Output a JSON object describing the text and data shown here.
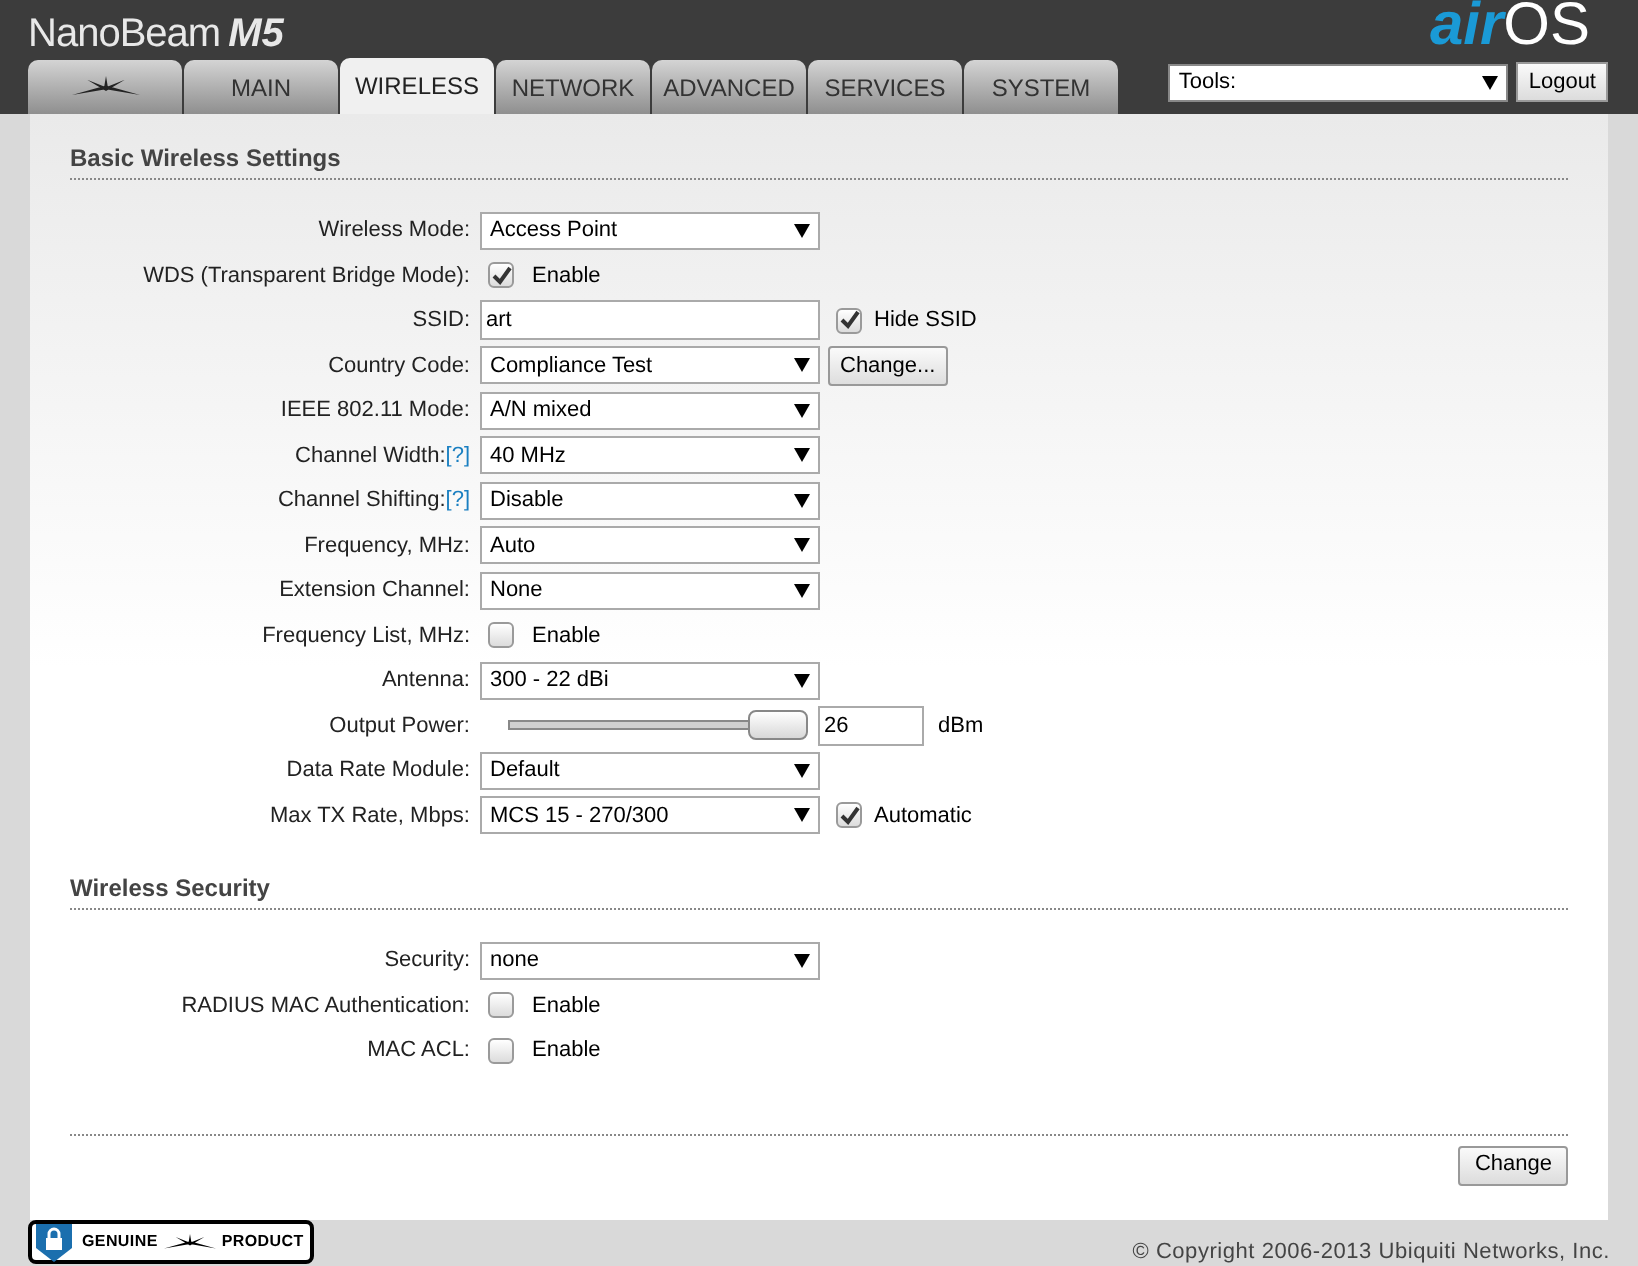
{
  "header": {
    "product": "NanoBeam",
    "model": "M5",
    "brand_a": "air",
    "brand_b": "OS"
  },
  "tabs": [
    {
      "kind": "logo",
      "selected": false
    },
    {
      "label": "MAIN",
      "selected": false
    },
    {
      "label": "WIRELESS",
      "selected": true
    },
    {
      "label": "NETWORK",
      "selected": false
    },
    {
      "label": "ADVANCED",
      "selected": false
    },
    {
      "label": "SERVICES",
      "selected": false
    },
    {
      "label": "SYSTEM",
      "selected": false
    }
  ],
  "tools": {
    "value": "Tools:"
  },
  "logout": "Logout",
  "sections": [
    {
      "title": "Basic Wireless Settings",
      "rows": [
        {
          "kind": "select",
          "label": "Wireless Mode:",
          "value": "Access Point"
        },
        {
          "kind": "checkbox",
          "label": "WDS (Transparent Bridge Mode):",
          "checked": true,
          "text": "Enable"
        },
        {
          "kind": "text",
          "label": "SSID:",
          "value": "art",
          "extra_check": {
            "checked": true,
            "text": "Hide SSID"
          }
        },
        {
          "kind": "select",
          "label": "Country Code:",
          "value": "Compliance Test",
          "button": "Change..."
        },
        {
          "kind": "select",
          "label": "IEEE 802.11 Mode:",
          "value": "A/N mixed"
        },
        {
          "kind": "select",
          "label": "Channel Width:",
          "help": "[?]",
          "value": "40 MHz"
        },
        {
          "kind": "select",
          "label": "Channel Shifting:",
          "help": "[?]",
          "value": "Disable"
        },
        {
          "kind": "select",
          "label": "Frequency, MHz:",
          "value": "Auto"
        },
        {
          "kind": "select",
          "label": "Extension Channel:",
          "value": "None"
        },
        {
          "kind": "checkbox",
          "label": "Frequency List, MHz:",
          "checked": false,
          "text": "Enable"
        },
        {
          "kind": "select",
          "label": "Antenna:",
          "value": "300 - 22 dBi"
        },
        {
          "kind": "slider",
          "label": "Output Power:",
          "level": 1,
          "value": "26",
          "unit": "dBm"
        },
        {
          "kind": "select",
          "label": "Data Rate Module:",
          "value": "Default"
        },
        {
          "kind": "select",
          "label": "Max TX Rate, Mbps:",
          "value": "MCS 15 - 270/300",
          "extra_check": {
            "checked": true,
            "text": "Automatic"
          }
        }
      ]
    },
    {
      "title": "Wireless Security",
      "rows": [
        {
          "kind": "select",
          "label": "Security:",
          "value": "none"
        },
        {
          "kind": "checkbox",
          "label": "RADIUS MAC Authentication:",
          "checked": false,
          "text": "Enable"
        },
        {
          "kind": "checkbox",
          "label": "MAC ACL:",
          "checked": false,
          "text": "Enable"
        }
      ]
    }
  ],
  "change_button": "Change",
  "footer": {
    "badge_left": "GENUINE",
    "badge_right": "PRODUCT",
    "copyright": "© Copyright 2006-2013 Ubiquiti Networks, Inc."
  }
}
